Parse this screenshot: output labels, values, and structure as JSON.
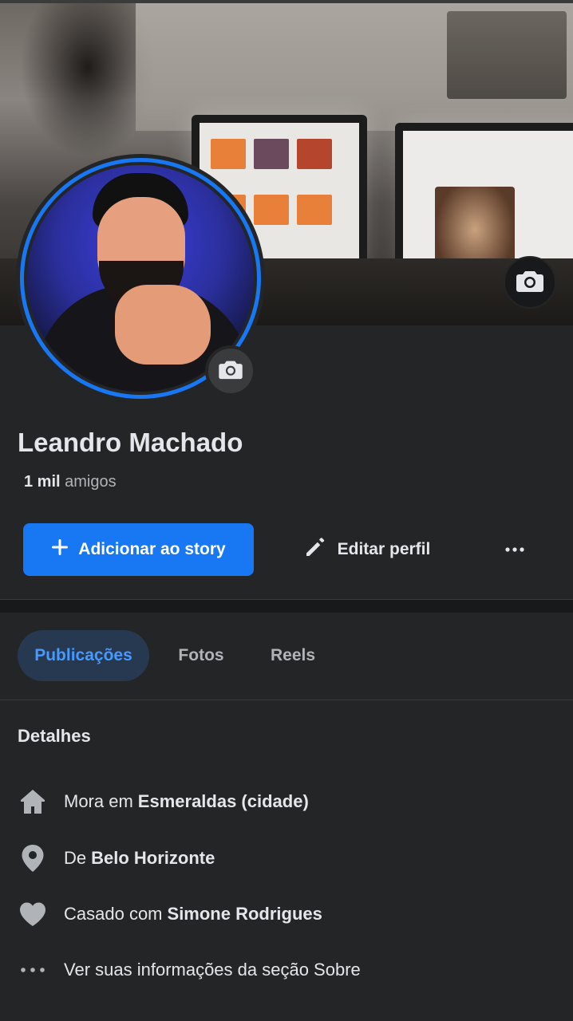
{
  "profile": {
    "name": "Leandro Machado",
    "friends_count": "1 mil",
    "friends_label": "amigos"
  },
  "actions": {
    "add_story": "Adicionar ao story",
    "edit_profile": "Editar perfil"
  },
  "tabs": [
    {
      "label": "Publicações",
      "active": true
    },
    {
      "label": "Fotos",
      "active": false
    },
    {
      "label": "Reels",
      "active": false
    }
  ],
  "details": {
    "title": "Detalhes",
    "items": [
      {
        "icon": "home-icon",
        "prefix": "Mora em",
        "value": "Esmeraldas (cidade)"
      },
      {
        "icon": "location-pin-icon",
        "prefix": "De",
        "value": "Belo Horizonte"
      },
      {
        "icon": "heart-icon",
        "prefix": "Casado com",
        "value": "Simone Rodrigues"
      },
      {
        "icon": "more-dots-icon",
        "prefix": "Ver suas informações da seção Sobre",
        "value": ""
      }
    ]
  },
  "colors": {
    "background": "#242526",
    "accent": "#1877f2",
    "active_tab_bg": "#263951",
    "active_tab_text": "#4599ff"
  }
}
